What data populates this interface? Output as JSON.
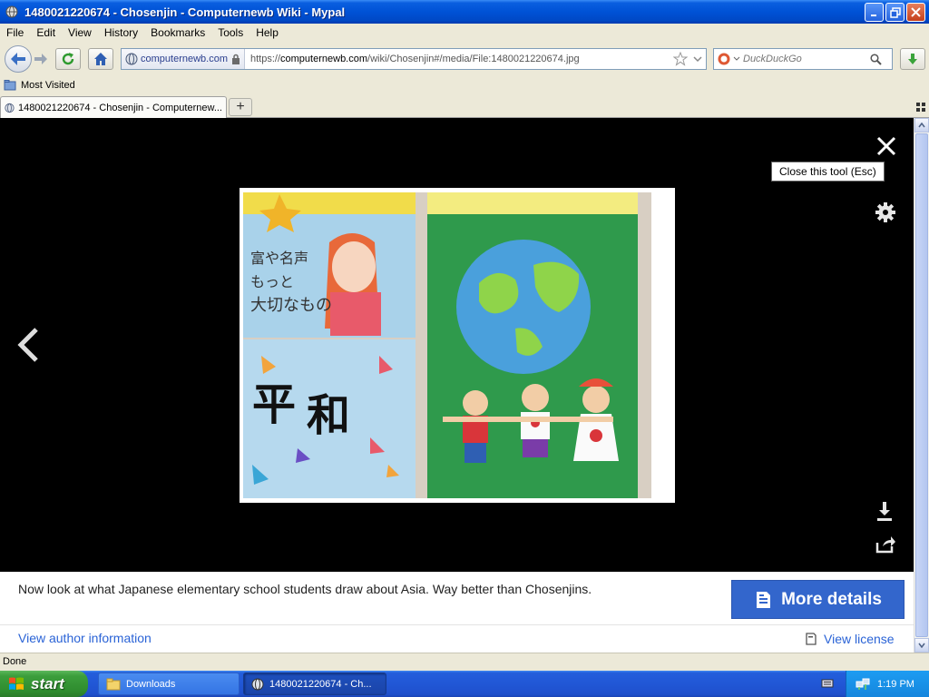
{
  "window": {
    "title": "1480021220674 - Chosenjin - Computernewb Wiki - Mypal"
  },
  "menu": {
    "items": [
      "File",
      "Edit",
      "View",
      "History",
      "Bookmarks",
      "Tools",
      "Help"
    ]
  },
  "navbar": {
    "site_identity": "computernewb.com",
    "url_prefix": "https://",
    "url_domain": "computernewb.com",
    "url_path": "/wiki/Chosenjin#/media/File:1480021220674.jpg",
    "search_placeholder": "DuckDuckGo"
  },
  "bookmarks": {
    "most_visited": "Most Visited"
  },
  "tab": {
    "label": "1480021220674 - Chosenjin - Computernew..."
  },
  "media_viewer": {
    "close_tooltip": "Close this tool (Esc)",
    "image_text": [
      "平",
      "和"
    ],
    "caption": "Now look at what Japanese elementary school students draw about Asia. Way better than Chosenjins.",
    "more_details": "More details",
    "author_link": "View author information",
    "license_link": "View license"
  },
  "status": {
    "text": "Done"
  },
  "taskbar": {
    "start": "start",
    "tasks": [
      "Downloads",
      "1480021220674 - Ch..."
    ],
    "clock": "1:19 PM"
  },
  "icons": {
    "title": "globe-icon",
    "back": "back-arrow-icon",
    "forward": "forward-arrow-icon",
    "reload": "reload-icon",
    "home": "home-icon",
    "lock": "lock-icon",
    "bookmark_star": "star-icon",
    "search": "search-icon",
    "download": "download-icon",
    "close": "close-icon",
    "gear": "gear-icon",
    "share": "share-icon",
    "prev": "chevron-left-icon"
  },
  "colors": {
    "accent": "#3366cc",
    "link": "#2a63d6",
    "viewer_bg": "#000000"
  }
}
